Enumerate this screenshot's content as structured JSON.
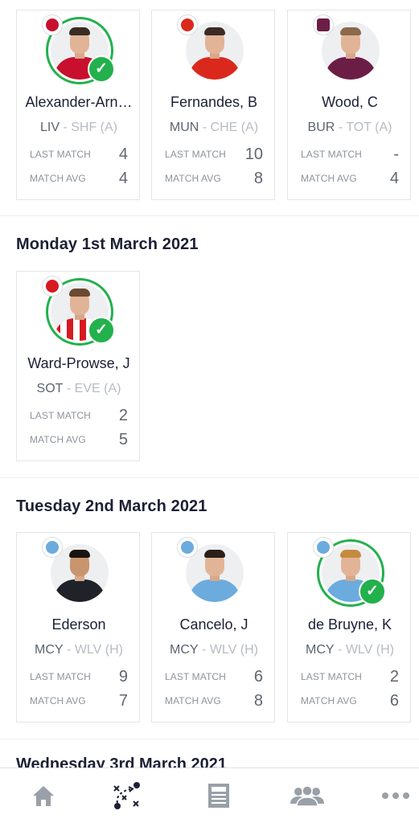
{
  "sections": [
    {
      "date": "",
      "players": [
        {
          "name": "Alexander-Arn…",
          "team": "LIV",
          "opponent": "SHF (A)",
          "last_match": "4",
          "match_avg": "4",
          "selected": true,
          "crest_color": "#c8102e",
          "shirt_color": "#c8102e"
        },
        {
          "name": "Fernandes, B",
          "team": "MUN",
          "opponent": "CHE (A)",
          "last_match": "10",
          "match_avg": "8",
          "selected": false,
          "crest_color": "#da291c",
          "shirt_color": "#da291c"
        },
        {
          "name": "Wood, C",
          "team": "BUR",
          "opponent": "TOT (A)",
          "last_match": "-",
          "match_avg": "4",
          "selected": false,
          "crest_color": "#6c1d45",
          "shirt_color": "#6c1d45"
        }
      ]
    },
    {
      "date": "Monday 1st March 2021",
      "players": [
        {
          "name": "Ward-Prowse, J",
          "team": "SOT",
          "opponent": "EVE (A)",
          "last_match": "2",
          "match_avg": "5",
          "selected": true,
          "crest_color": "#d71920",
          "shirt_color": "#d71920"
        }
      ]
    },
    {
      "date": "Tuesday 2nd March 2021",
      "players": [
        {
          "name": "Ederson",
          "team": "MCY",
          "opponent": "WLV (H)",
          "last_match": "9",
          "match_avg": "7",
          "selected": false,
          "crest_color": "#6cabdd",
          "shirt_color": "#1f2329"
        },
        {
          "name": "Cancelo, J",
          "team": "MCY",
          "opponent": "WLV (H)",
          "last_match": "6",
          "match_avg": "8",
          "selected": false,
          "crest_color": "#6cabdd",
          "shirt_color": "#6cabdd"
        },
        {
          "name": "de Bruyne, K",
          "team": "MCY",
          "opponent": "WLV (H)",
          "last_match": "2",
          "match_avg": "6",
          "selected": true,
          "crest_color": "#6cabdd",
          "shirt_color": "#6cabdd"
        }
      ]
    },
    {
      "date": "Wednesday 3rd March 2021",
      "players": []
    }
  ],
  "labels": {
    "last_match": "LAST MATCH",
    "match_avg": "MATCH AVG",
    "separator": " - ",
    "check_glyph": "✓"
  },
  "bottom_nav": [
    {
      "icon": "home-icon",
      "active": false
    },
    {
      "icon": "tactics-icon",
      "active": true
    },
    {
      "icon": "news-icon",
      "active": false
    },
    {
      "icon": "leagues-icon",
      "active": false
    },
    {
      "icon": "more-icon",
      "active": false
    }
  ],
  "colors": {
    "accent_green": "#22b14c",
    "navy": "#1b2035",
    "nav_inactive": "#9aa0a8",
    "nav_active": "#1b2035"
  }
}
